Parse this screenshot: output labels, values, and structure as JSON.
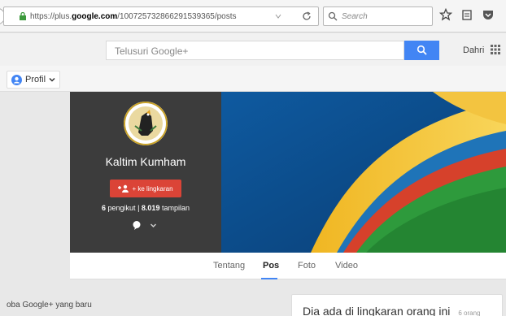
{
  "browser": {
    "url_prefix": "https://plus.",
    "url_domain": "google.com",
    "url_path": "/100725732866291539365/posts",
    "search_placeholder": "Search"
  },
  "header": {
    "search_placeholder": "Telusuri Google+",
    "user_name": "Dahri"
  },
  "subbar": {
    "profile_label": "Profil"
  },
  "profile": {
    "name": "Kaltim Kumham",
    "add_circle_label": "+ ke lingkaran",
    "followers_count": "6",
    "followers_label": "pengikut",
    "views_count": "8.019",
    "views_label": "tampilan"
  },
  "tabs": [
    {
      "label": "Tentang"
    },
    {
      "label": "Pos"
    },
    {
      "label": "Foto"
    },
    {
      "label": "Video"
    }
  ],
  "footer": {
    "try_new": "oba Google+ yang baru",
    "circle_card_title": "Dia ada di lingkaran orang ini",
    "circle_card_count": "6 orang"
  },
  "colors": {
    "accent_blue": "#4285f4",
    "add_red": "#db4437",
    "card_dark": "#3c3c3c"
  }
}
